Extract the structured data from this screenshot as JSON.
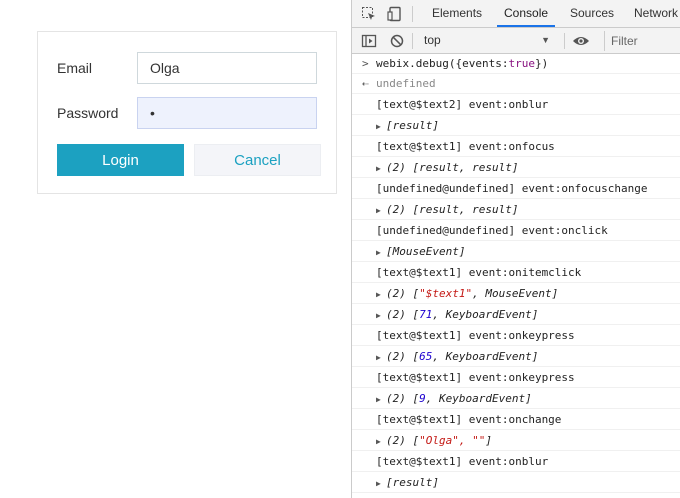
{
  "form": {
    "email_label": "Email",
    "email_value": "Olga",
    "password_label": "Password",
    "password_value": "•",
    "login_label": "Login",
    "cancel_label": "Cancel"
  },
  "devtools": {
    "tabs": [
      "Elements",
      "Console",
      "Sources",
      "Network"
    ],
    "active_tab": "Console",
    "context": "top",
    "filter_placeholder": "Filter",
    "accent": "#1a73e8"
  },
  "console": {
    "input": {
      "code": "webix.debug(",
      "arg_key": "{events:",
      "arg_value": "true",
      "close": "})"
    },
    "result": "undefined",
    "entries": [
      {
        "type": "log",
        "text": "[text@$text2] event:onblur"
      },
      {
        "type": "obj",
        "text": "[result]"
      },
      {
        "type": "log",
        "text": "[text@$text1] event:onfocus"
      },
      {
        "type": "obj",
        "text": "(2) [result, result]"
      },
      {
        "type": "log",
        "text": "[undefined@undefined] event:onfocuschange"
      },
      {
        "type": "obj",
        "text": "(2) [result, result]"
      },
      {
        "type": "log",
        "text": "[undefined@undefined] event:onclick"
      },
      {
        "type": "obj",
        "text": "[MouseEvent]"
      },
      {
        "type": "log",
        "text": "[text@$text1] event:onitemclick"
      },
      {
        "type": "obj",
        "prefix": "(2) [",
        "str": "\"$text1\"",
        "suffix": ", MouseEvent]"
      },
      {
        "type": "obj",
        "prefix": "(2) [",
        "num": "71",
        "suffix": ", KeyboardEvent]"
      },
      {
        "type": "log",
        "text": "[text@$text1] event:onkeypress"
      },
      {
        "type": "obj",
        "prefix": "(2) [",
        "num": "65",
        "suffix": ", KeyboardEvent]"
      },
      {
        "type": "log",
        "text": "[text@$text1] event:onkeypress"
      },
      {
        "type": "obj",
        "prefix": "(2) [",
        "num": "9",
        "suffix": ", KeyboardEvent]"
      },
      {
        "type": "log",
        "text": "[text@$text1] event:onchange"
      },
      {
        "type": "obj",
        "prefix": "(2) [",
        "str": "\"Olga\", \"\"",
        "suffix": "]"
      },
      {
        "type": "log",
        "text": "[text@$text1] event:onblur"
      },
      {
        "type": "obj",
        "text": "[result]"
      }
    ]
  },
  "icons": {
    "inspect": "inspect-icon",
    "device": "device-toggle-icon",
    "sidebar": "sidebar-toggle-icon",
    "clear": "clear-console-icon",
    "eye": "live-expression-icon"
  }
}
